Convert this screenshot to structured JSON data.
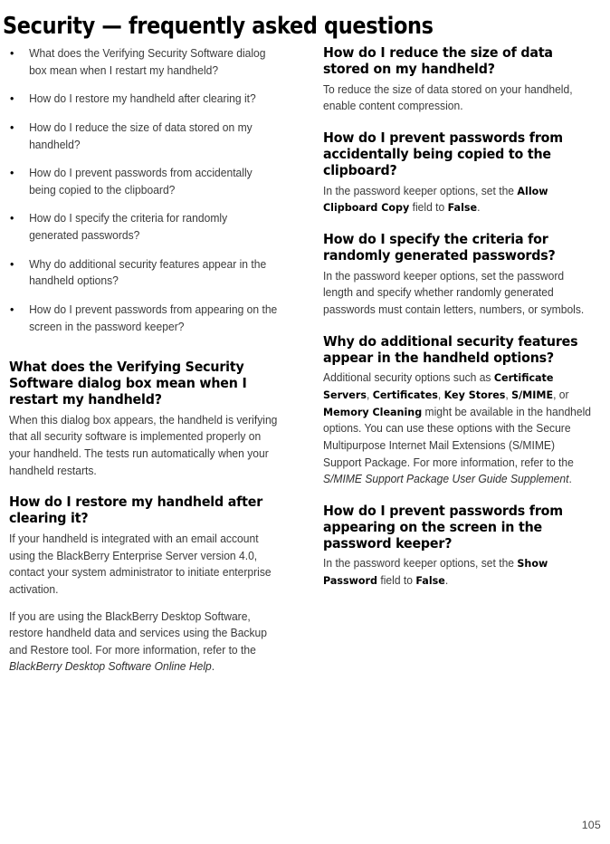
{
  "page": {
    "title": "Security — frequently asked questions",
    "number": "105"
  },
  "faq_list": [
    "What does the Verifying Security Software dialog box mean when I restart my handheld?",
    "How do I restore my handheld after clearing it?",
    "How do I reduce the size of data stored on my handheld?",
    "How do I prevent passwords from accidentally being copied to the clipboard?",
    "How do I specify the criteria for randomly generated passwords?",
    "Why do additional security features appear in the handheld options?",
    "How do I prevent passwords from appearing on the screen in the password keeper?"
  ],
  "left_column": {
    "sections": [
      {
        "heading": "What does the Verifying Security Software dialog box mean when I restart my handheld?",
        "body": "When this dialog box appears, the handheld is verifying that all security software is implemented properly on your handheld. The tests run automatically when your handheld restarts."
      },
      {
        "heading": "How do I restore my handheld after clearing it?",
        "body_1": "If your handheld is integrated with an email account using the BlackBerry Enterprise Server version 4.0, contact your system administrator to initiate enterprise activation.",
        "body_2_pre": "If you are using the BlackBerry Desktop Software, restore handheld data and services using the Backup and Restore tool. For more information, refer to the ",
        "body_2_ref": "BlackBerry Desktop Software Online Help",
        "body_2_post": "."
      }
    ]
  },
  "right_column": {
    "sections": [
      {
        "heading": "How do I reduce the size of data stored on my handheld?",
        "body": "To reduce the size of data stored on your handheld, enable content compression."
      },
      {
        "heading": "How do I prevent passwords from accidentally being copied to the clipboard?",
        "body_pre": "In the password keeper options, set the ",
        "body_field": "Allow Clipboard Copy",
        "body_mid": " field to ",
        "body_value": "False",
        "body_post": "."
      },
      {
        "heading": "How do I specify the criteria for randomly generated passwords?",
        "body": "In the password keeper options, set the password length and specify whether randomly generated passwords must contain letters, numbers, or symbols."
      },
      {
        "heading": "Why do additional security features appear in the handheld options?",
        "body_pre": "Additional security options such as ",
        "body_opt_1": "Certificate Servers",
        "body_sep_1": ", ",
        "body_opt_2": "Certificates",
        "body_sep_2": ", ",
        "body_opt_3": "Key Stores",
        "body_sep_3": ", ",
        "body_opt_4": "S/MIME",
        "body_sep_4": ", or ",
        "body_opt_5": "Memory Cleaning",
        "body_mid": " might be available in the handheld options. You can use these options with the Secure Multipurpose Internet Mail Extensions (S/MIME) Support Package. For more information, refer to the ",
        "body_ref": "S/MIME Support Package User Guide Supplement",
        "body_post": "."
      },
      {
        "heading": "How do I prevent passwords from appearing on the screen in the password keeper?",
        "body_pre": "In the password keeper options, set the ",
        "body_field": "Show Password",
        "body_mid": " field to ",
        "body_value": "False",
        "body_post": "."
      }
    ]
  }
}
